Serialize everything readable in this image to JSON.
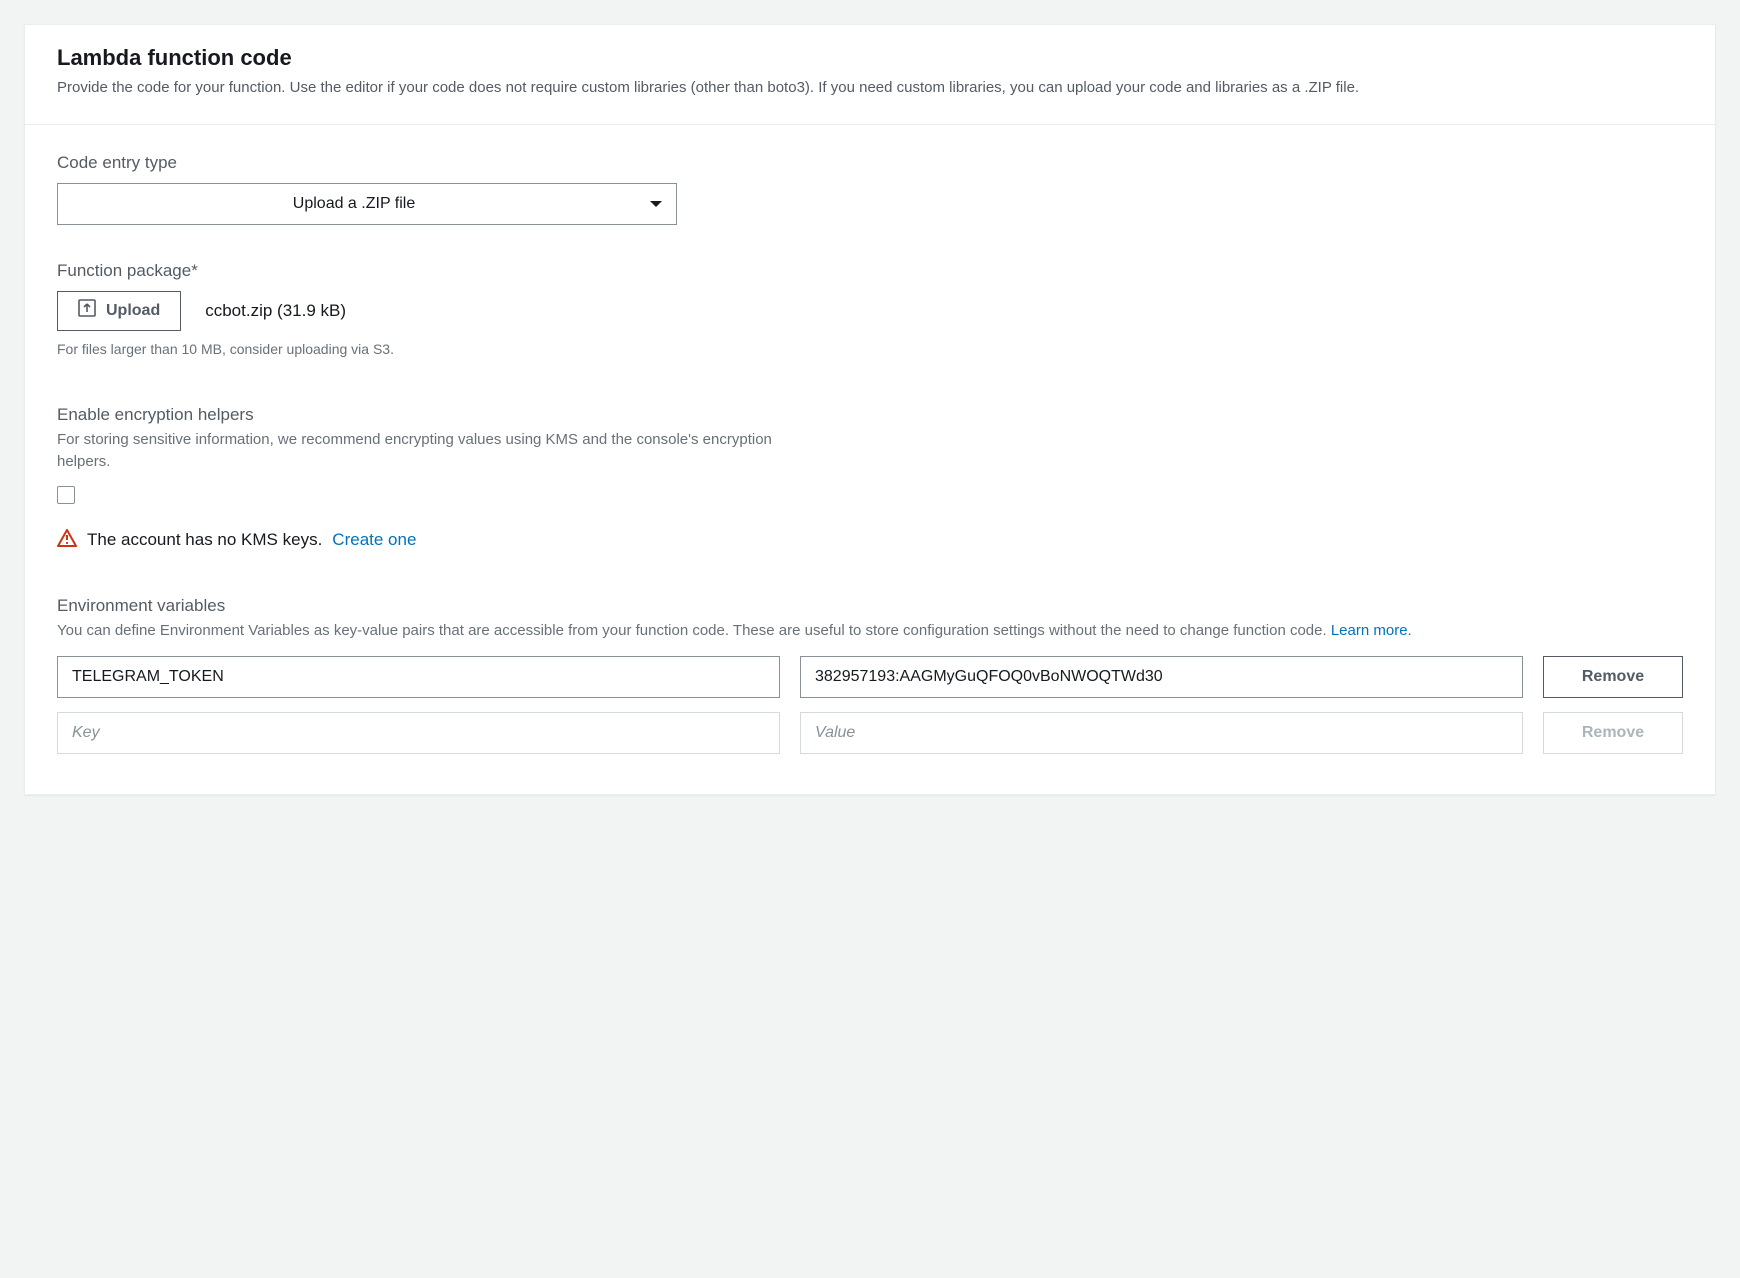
{
  "header": {
    "title": "Lambda function code",
    "subtitle": "Provide the code for your function. Use the editor if your code does not require custom libraries (other than boto3). If you need custom libraries, you can upload your code and libraries as a .ZIP file."
  },
  "code_entry": {
    "label": "Code entry type",
    "value": "Upload a .ZIP file"
  },
  "package": {
    "label": "Function package*",
    "upload_button": "Upload",
    "filename": "ccbot.zip (31.9 kB)",
    "hint": "For files larger than 10 MB, consider uploading via S3."
  },
  "encryption": {
    "title": "Enable encryption helpers",
    "help": "For storing sensitive information, we recommend encrypting values using KMS and the console's encryption helpers.",
    "warning_text": "The account has no KMS keys.",
    "create_link": "Create one"
  },
  "env": {
    "title": "Environment variables",
    "help_prefix": "You can define Environment Variables as key-value pairs that are accessible from your function code. These are useful to store configuration settings without the need to change function code. ",
    "learn_more": "Learn more.",
    "rows": [
      {
        "key": "TELEGRAM_TOKEN",
        "value": "382957193:AAGMyGuQFOQ0vBoNWOQTWd30",
        "remove": "Remove",
        "placeholder_key": "",
        "placeholder_value": ""
      },
      {
        "key": "",
        "value": "",
        "remove": "Remove",
        "placeholder_key": "Key",
        "placeholder_value": "Value"
      }
    ]
  }
}
